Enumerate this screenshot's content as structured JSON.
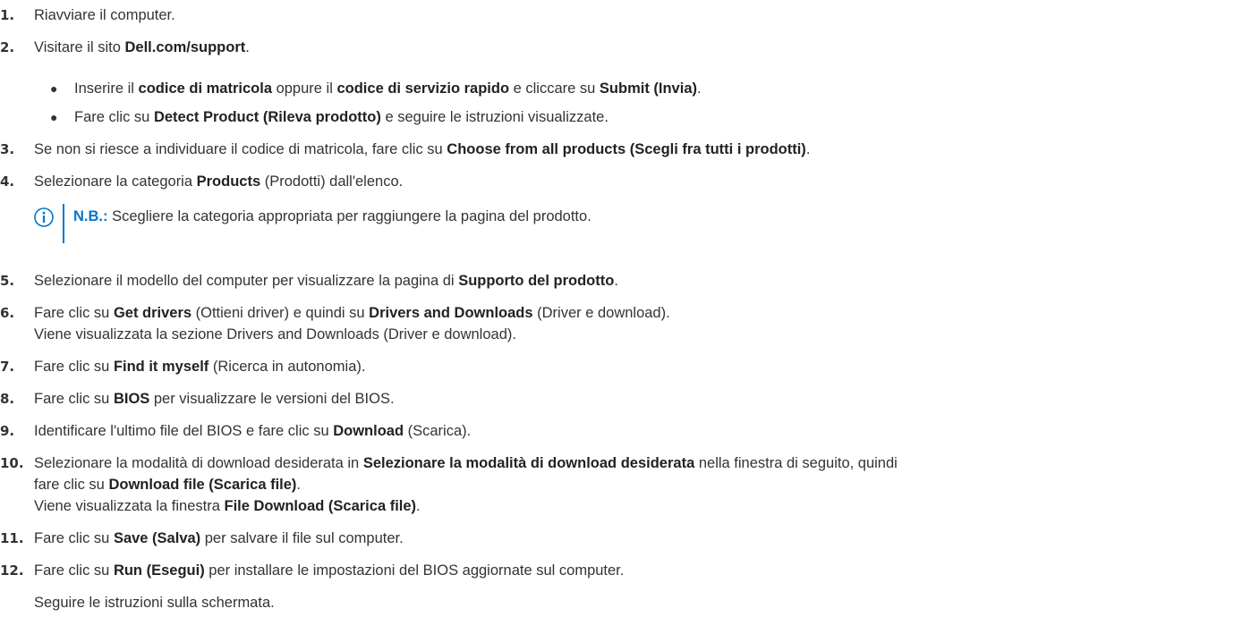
{
  "steps": [
    {
      "num": "1.",
      "parts": [
        "Riavviare il computer."
      ]
    },
    {
      "num": "2.",
      "parts": [
        "Visitare il sito ",
        "Dell.com/support",
        "."
      ]
    },
    {
      "num": "3.",
      "parts": [
        "Se non si riesce a individuare il codice di matricola, fare clic su ",
        "Choose from all products (Scegli fra tutti i prodotti)",
        "."
      ]
    },
    {
      "num": "4.",
      "parts": [
        "Selezionare la categoria ",
        "Products",
        " (Prodotti) dall'elenco."
      ]
    },
    {
      "num": "5.",
      "parts": [
        "Selezionare il modello del computer per visualizzare la pagina di ",
        "Supporto del prodotto",
        "."
      ]
    },
    {
      "num": "6.",
      "parts": [
        "Fare clic su ",
        "Get drivers",
        " (Ottieni driver) e quindi su ",
        "Drivers and Downloads",
        " (Driver e download)."
      ],
      "continuation": "Viene visualizzata la sezione Drivers and Downloads (Driver e download)."
    },
    {
      "num": "7.",
      "parts": [
        "Fare clic su ",
        "Find it myself",
        " (Ricerca in autonomia)."
      ]
    },
    {
      "num": "8.",
      "parts": [
        "Fare clic su ",
        "BIOS",
        " per visualizzare le versioni del BIOS."
      ]
    },
    {
      "num": "9.",
      "parts": [
        "Identificare l'ultimo file del BIOS e fare clic su ",
        "Download",
        " (Scarica)."
      ]
    },
    {
      "num": "10.",
      "parts": [
        "Selezionare la modalità di download desiderata in ",
        "Selezionare la modalità di download desiderata",
        " nella finestra di seguito, quindi"
      ],
      "line2": [
        "fare clic su ",
        "Download file (Scarica file)",
        "."
      ],
      "line3": [
        "Viene visualizzata la finestra ",
        "File Download (Scarica file)",
        "."
      ]
    },
    {
      "num": "11.",
      "parts": [
        "Fare clic su ",
        "Save (Salva)",
        " per salvare il file sul computer."
      ]
    },
    {
      "num": "12.",
      "parts": [
        "Fare clic su ",
        "Run (Esegui)",
        " per installare le impostazioni del BIOS aggiornate sul computer."
      ]
    }
  ],
  "bullets": [
    {
      "parts": [
        "Inserire il ",
        "codice di matricola",
        " oppure il ",
        "codice di servizio rapido",
        " e cliccare su ",
        "Submit (Invia)",
        "."
      ]
    },
    {
      "parts": [
        "Fare clic su ",
        "Detect Product (Rileva prodotto)",
        " e seguire le istruzioni visualizzate."
      ]
    }
  ],
  "note": {
    "label": "N.B.:",
    "text": " Scegliere la categoria appropriata per raggiungere la pagina del prodotto."
  },
  "final_text": "Seguire le istruzioni sulla schermata."
}
